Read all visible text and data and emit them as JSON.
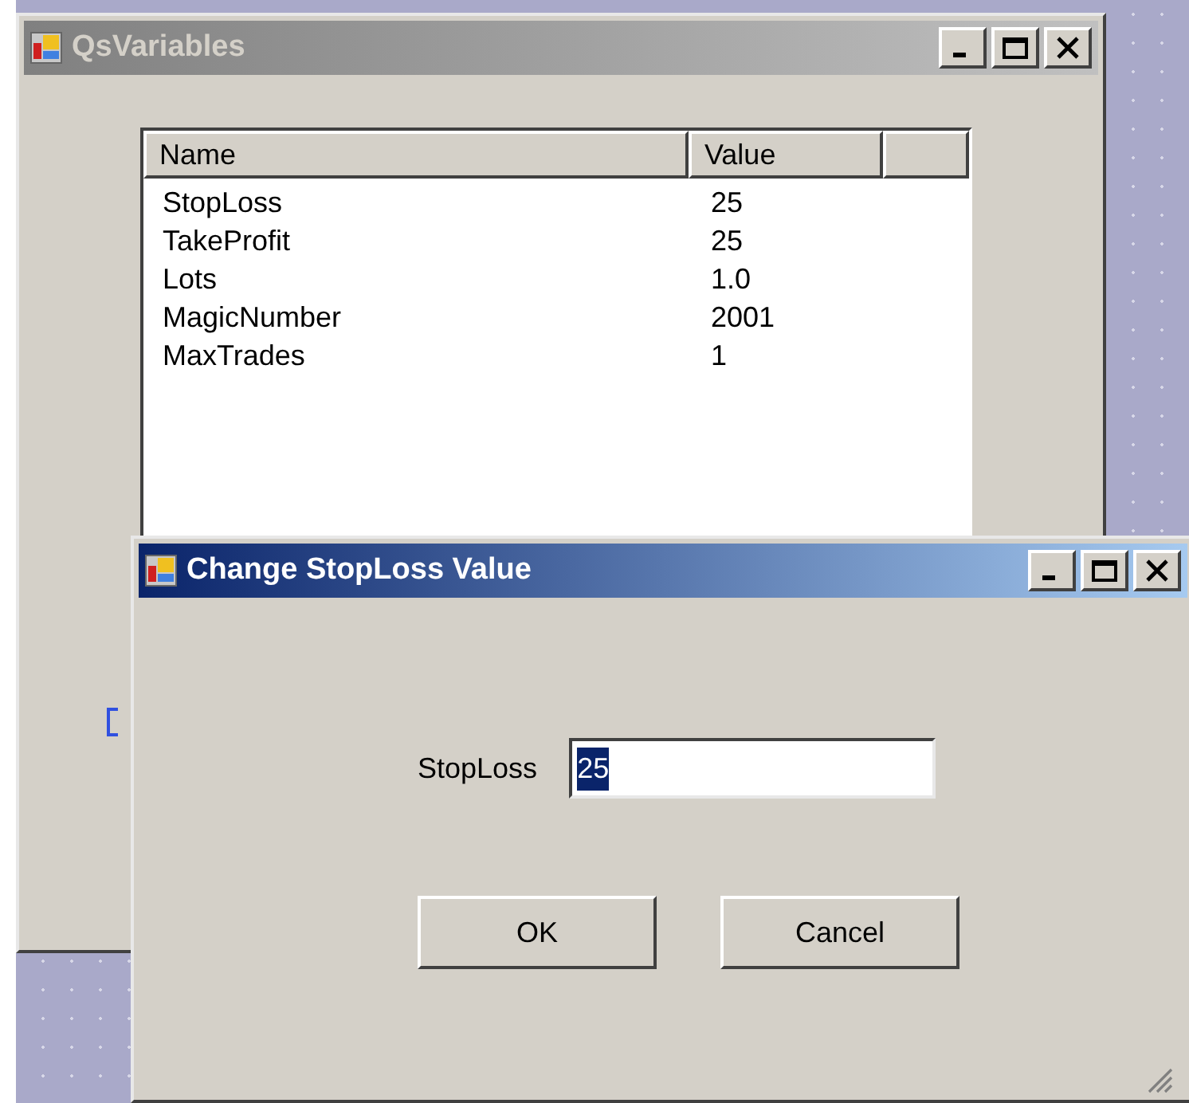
{
  "main_window": {
    "title": "QsVariables",
    "active": false,
    "columns": [
      "Name",
      "Value"
    ],
    "rows": [
      {
        "name": "StopLoss",
        "value": "25"
      },
      {
        "name": "TakeProfit",
        "value": "25"
      },
      {
        "name": "Lots",
        "value": "1.0"
      },
      {
        "name": "MagicNumber",
        "value": "2001"
      },
      {
        "name": "MaxTrades",
        "value": "1"
      }
    ]
  },
  "dialog": {
    "title": "Change StopLoss Value",
    "active": true,
    "field_label": "StopLoss",
    "field_value": "25",
    "value_selected": true,
    "buttons": [
      "OK",
      "Cancel"
    ]
  }
}
